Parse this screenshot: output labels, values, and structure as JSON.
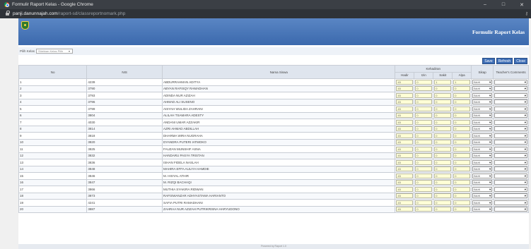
{
  "window": {
    "title": "Formulir Raport Kelas - Google Chrome",
    "minimize": "–",
    "maximize": "□",
    "close": "✕"
  },
  "address": {
    "host": "panji.danunnajah.com",
    "path": "/raport-sd/classreportnomark.php"
  },
  "header": {
    "title": "Formulir Raport Kelas"
  },
  "filter": {
    "label": "Pilih Kelas",
    "placeholder": "Silahkan Kelas Pilih"
  },
  "toolbar": {
    "save": "Save",
    "refresh": "Refresh",
    "close": "Close"
  },
  "table": {
    "headers": {
      "no": "No",
      "nis": "NIS",
      "nama": "Nama Siswa",
      "kehadiran": "Kehadiran",
      "hadir": "Hadir",
      "izin": "Izin",
      "sakit": "Sakit",
      "alpa": "Alpa",
      "sikap": "Sikap",
      "comments": "Teacher's Comments"
    },
    "rows": [
      {
        "no": "1",
        "nis": "4239",
        "nama": "ABDURRAHMAN ADITYA",
        "hadir": "45",
        "izin": "0",
        "sakit": "1",
        "alpa": "1",
        "sikap": "BAIK"
      },
      {
        "no": "2",
        "nis": "3790",
        "nama": "ABYAN RAFISQY RAMADHAN",
        "hadir": "45",
        "izin": "0",
        "sakit": "0",
        "alpa": "0",
        "sikap": "BAIK"
      },
      {
        "no": "3",
        "nis": "3793",
        "nama": "ADINDA NUR AZIZAH",
        "hadir": "45",
        "izin": "0",
        "sakit": "0",
        "alpa": "0",
        "sikap": "BAIK"
      },
      {
        "no": "4",
        "nis": "3796",
        "nama": "AHMAD ALI SUSENO",
        "hadir": "45",
        "izin": "0",
        "sakit": "0",
        "alpa": "0",
        "sikap": "BAIK"
      },
      {
        "no": "5",
        "nis": "3799",
        "nama": "AISYAH WULIDA ZAHRANI",
        "hadir": "45",
        "izin": "0",
        "sakit": "0",
        "alpa": "0",
        "sikap": "BAIK"
      },
      {
        "no": "6",
        "nis": "3804",
        "nama": "ALILAH TSAMARA ADESTY",
        "hadir": "45",
        "izin": "0",
        "sakit": "0",
        "alpa": "0",
        "sikap": "BAIK"
      },
      {
        "no": "7",
        "nis": "4030",
        "nama": "ANDANI UMAR AZZAKIR",
        "hadir": "45",
        "izin": "0",
        "sakit": "0",
        "alpa": "0",
        "sikap": "BAIK"
      },
      {
        "no": "8",
        "nis": "3814",
        "nama": "AZRI AHMAD ABDILLAH",
        "hadir": "45",
        "izin": "0",
        "sakit": "0",
        "alpa": "0",
        "sikap": "BAIK"
      },
      {
        "no": "9",
        "nis": "3818",
        "nama": "DHARMA WIRA NUGRAHA",
        "hadir": "45",
        "izin": "0",
        "sakit": "0",
        "alpa": "0",
        "sikap": "BAIK"
      },
      {
        "no": "10",
        "nis": "3820",
        "nama": "DYANDRA PUTERI IATMOKO",
        "hadir": "45",
        "izin": "0",
        "sakit": "0",
        "alpa": "0",
        "sikap": "BAIK"
      },
      {
        "no": "11",
        "nis": "3825",
        "nama": "FAUZAN MUNSHIF ASNA",
        "hadir": "45",
        "izin": "0",
        "sakit": "0",
        "alpa": "0",
        "sikap": "BAIK"
      },
      {
        "no": "12",
        "nis": "3832",
        "nama": "HANDARU PASYA TRISTAN",
        "hadir": "45",
        "izin": "0",
        "sakit": "0",
        "alpa": "0",
        "sikap": "BAIK"
      },
      {
        "no": "13",
        "nis": "3836",
        "nama": "ISHAN FIDELA NASLAH",
        "hadir": "45",
        "izin": "0",
        "sakit": "0",
        "alpa": "0",
        "sikap": "BAIK"
      },
      {
        "no": "14",
        "nis": "3848",
        "nama": "MAHIRA EFFA AULIYA HAMDIE",
        "hadir": "45",
        "izin": "0",
        "sakit": "0",
        "alpa": "0",
        "sikap": "BAIK"
      },
      {
        "no": "15",
        "nis": "3846",
        "nama": "M. HISYAL ATHIR",
        "hadir": "45",
        "izin": "0",
        "sakit": "0",
        "alpa": "0",
        "sikap": "BAIK"
      },
      {
        "no": "16",
        "nis": "3847",
        "nama": "M. RIZQI BACHAQI",
        "hadir": "45",
        "izin": "0",
        "sakit": "0",
        "alpa": "0",
        "sikap": "BAIK"
      },
      {
        "no": "17",
        "nis": "3866",
        "nama": "MUTHIA SYAKIRA RIDWAN",
        "hadir": "45",
        "izin": "0",
        "sakit": "0",
        "alpa": "0",
        "sikap": "BAIK"
      },
      {
        "no": "18",
        "nis": "3873",
        "nama": "RAFISWANZAR ADHYASTAMA HARIANTO",
        "hadir": "45",
        "izin": "0",
        "sakit": "0",
        "alpa": "0",
        "sikap": "BAIK"
      },
      {
        "no": "19",
        "nis": "4241",
        "nama": "SAFIA PUTRI RAMADHANI",
        "hadir": "45",
        "izin": "0",
        "sakit": "0",
        "alpa": "0",
        "sikap": "BAIK"
      },
      {
        "no": "20",
        "nis": "3887",
        "nama": "ZAHRAA NUR AZIZAH PUTRIKRISNA HARYUDONO",
        "hadir": "45",
        "izin": "0",
        "sakit": "0",
        "alpa": "0",
        "sikap": "BAIK"
      }
    ]
  },
  "footer": {
    "text": "Powered by Raport 1.0"
  },
  "icons": {
    "chevron": "▾",
    "key": "⚷"
  }
}
